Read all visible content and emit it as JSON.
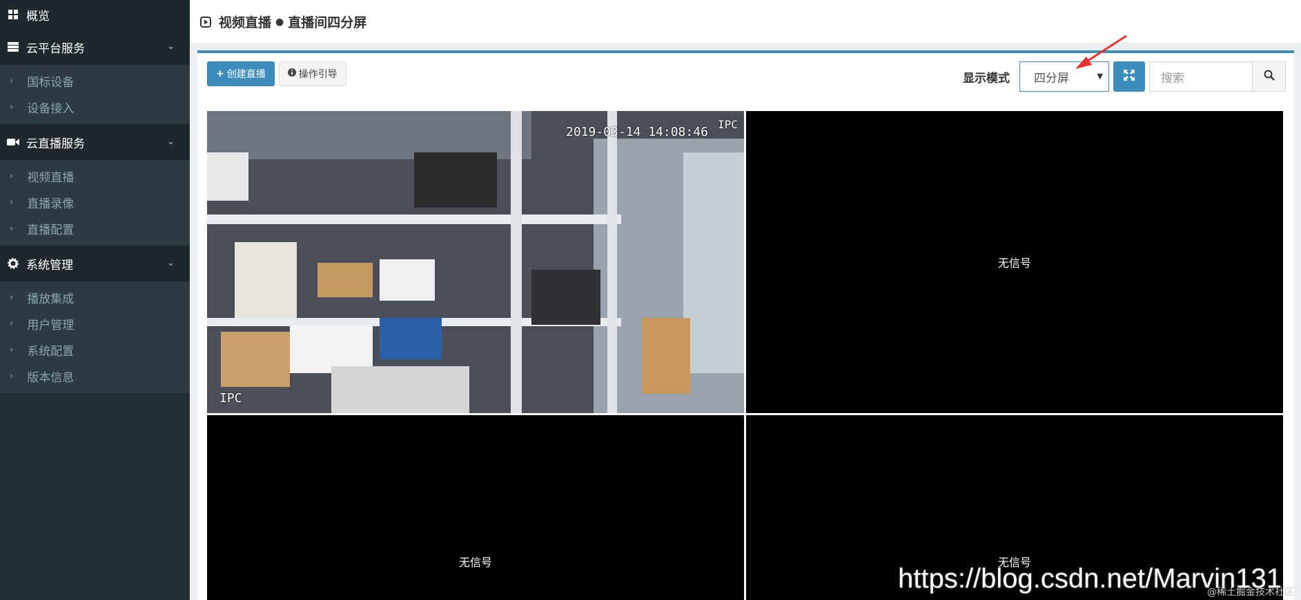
{
  "sidebar": {
    "overview": "概览",
    "groups": [
      {
        "title": "云平台服务",
        "items": [
          "国标设备",
          "设备接入"
        ]
      },
      {
        "title": "云直播服务",
        "items": [
          "视频直播",
          "直播录像",
          "直播配置"
        ]
      },
      {
        "title": "系统管理",
        "items": [
          "播放集成",
          "用户管理",
          "系统配置",
          "版本信息"
        ]
      }
    ]
  },
  "header": {
    "title": "视频直播",
    "subtitle": "直播间四分屏"
  },
  "toolbar": {
    "create_label": "创建直播",
    "guide_label": "操作引导",
    "mode_label": "显示模式",
    "mode_value": "四分屏",
    "search_placeholder": "搜索"
  },
  "video": {
    "timestamp": "2019-03-14 14:08:46",
    "ipc_top": "IPC",
    "ipc_bottom": "IPC",
    "no_signal": "无信号"
  },
  "watermark": {
    "url": "https://blog.csdn.net/Marvin131",
    "sub": "@稀土掘金技术社区"
  },
  "colors": {
    "accent": "#3c8dbc",
    "sidebar": "#222d32"
  }
}
